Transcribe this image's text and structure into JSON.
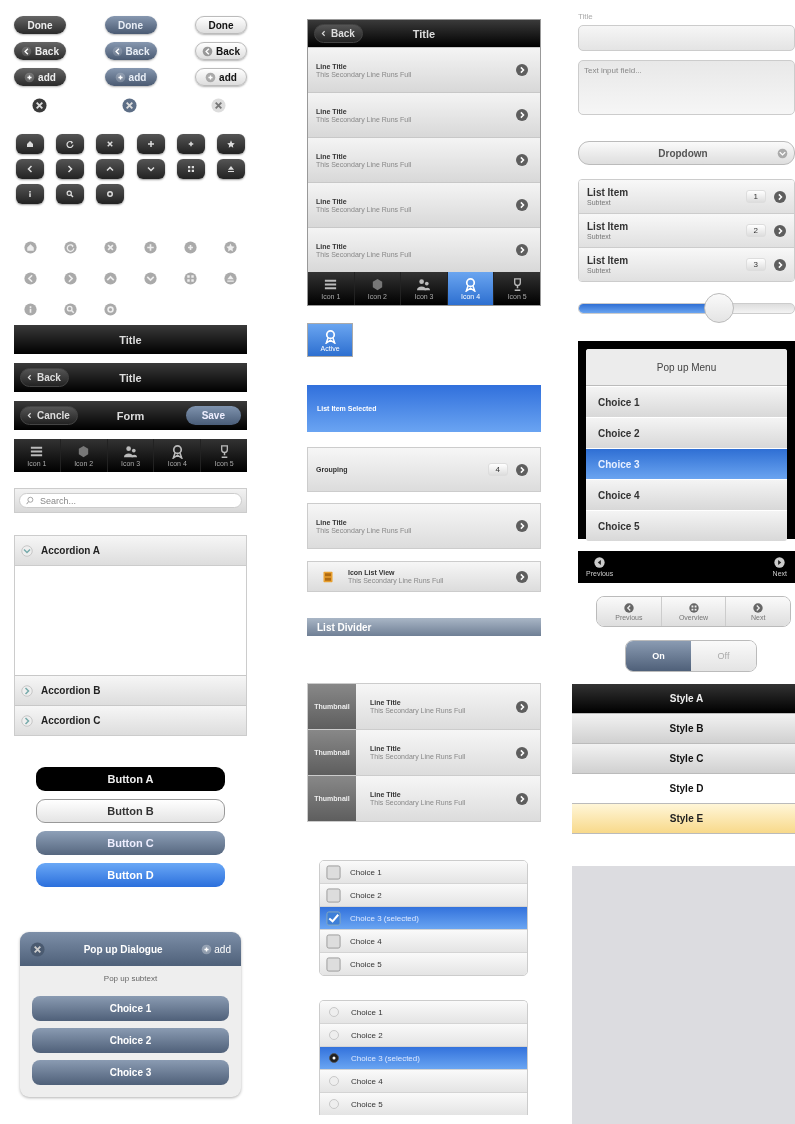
{
  "button_rows": [
    [
      {
        "kind": "text",
        "label": "Done"
      },
      {
        "kind": "text",
        "label": "Done"
      },
      {
        "kind": "text",
        "label": "Done"
      }
    ],
    [
      {
        "kind": "back",
        "label": "Back"
      },
      {
        "kind": "back",
        "label": "Back"
      },
      {
        "kind": "back",
        "label": "Back"
      }
    ],
    [
      {
        "kind": "add",
        "label": "add"
      },
      {
        "kind": "add",
        "label": "add"
      },
      {
        "kind": "add",
        "label": "add"
      }
    ],
    [
      {
        "kind": "close"
      },
      {
        "kind": "close"
      },
      {
        "kind": "close"
      }
    ]
  ],
  "title_bar": {
    "title": "Title"
  },
  "back_bar": {
    "back": "Back",
    "title": "Title"
  },
  "form_bar": {
    "cancel": "Cancle",
    "title": "Form",
    "save": "Save"
  },
  "tab_bar": [
    {
      "label": "Icon 1",
      "selected": false
    },
    {
      "label": "Icon 2",
      "selected": false
    },
    {
      "label": "Icon 3",
      "selected": false
    },
    {
      "label": "Icon 4",
      "selected": false
    },
    {
      "label": "Icon 5",
      "selected": false
    }
  ],
  "search": {
    "placeholder": "Search..."
  },
  "accordion": [
    {
      "title": "Accordion A",
      "expanded": true
    },
    {
      "title": "Accordion B",
      "expanded": false
    },
    {
      "title": "Accordion C",
      "expanded": false
    }
  ],
  "style_buttons": [
    {
      "label": "Button A"
    },
    {
      "label": "Button B"
    },
    {
      "label": "Button C"
    },
    {
      "label": "Button D"
    }
  ],
  "dialog": {
    "title": "Pop up Dialogue",
    "add": "add",
    "subtext": "Pop up subtext",
    "choices": [
      "Choice 1",
      "Choice 2",
      "Choice 3"
    ]
  },
  "phone": {
    "back": "Back",
    "title": "Title",
    "rows": [
      {
        "title": "Line Title",
        "subtitle": "This Secondary Line Runs Full"
      },
      {
        "title": "Line Title",
        "subtitle": "This Secondary Line Runs Full"
      },
      {
        "title": "Line Title",
        "subtitle": "This Secondary Line Runs Full"
      },
      {
        "title": "Line Title",
        "subtitle": "This Secondary Line Runs Full"
      },
      {
        "title": "Line Title",
        "subtitle": "This Secondary Line Runs Full"
      }
    ],
    "tabs": [
      {
        "label": "Icon 1",
        "selected": false
      },
      {
        "label": "Icon 2",
        "selected": false
      },
      {
        "label": "Icon 3",
        "selected": false
      },
      {
        "label": "Icon 4",
        "selected": true
      },
      {
        "label": "Icon 5",
        "selected": false
      }
    ]
  },
  "active_tab": {
    "label": "Active",
    "selected": true
  },
  "selected_item": {
    "label": "List Item Selected",
    "selected": true
  },
  "grouping": {
    "label": "Grouping",
    "count": "4"
  },
  "line_item": {
    "title": "Line Title",
    "subtitle": "This Secondary Line Runs Full"
  },
  "icon_item": {
    "title": "Icon List View",
    "subtitle": "This Secondary Line Runs Full"
  },
  "list_divider": "List Divider",
  "thumb_list": [
    {
      "thumbnail": "Thumbnail",
      "title": "Line Title",
      "subtitle": "This Secondary Line Runs Full"
    },
    {
      "thumbnail": "Thumbnail",
      "title": "Line Title",
      "subtitle": "This Secondary Line Runs Full"
    },
    {
      "thumbnail": "Thumbnail",
      "title": "Line Title",
      "subtitle": "This Secondary Line Runs Full"
    }
  ],
  "checkbox_list": [
    {
      "label": "Choice 1",
      "checked": false
    },
    {
      "label": "Choice 2",
      "checked": false
    },
    {
      "label": "Choice 3 (selected)",
      "checked": true
    },
    {
      "label": "Choice 4",
      "checked": false
    },
    {
      "label": "Choice 5",
      "checked": false
    }
  ],
  "radio_list": [
    {
      "label": "Choice 1",
      "selected": false
    },
    {
      "label": "Choice 2",
      "selected": false
    },
    {
      "label": "Choice 3 (selected)",
      "selected": true
    },
    {
      "label": "Choice 4",
      "selected": false
    },
    {
      "label": "Choice 5",
      "selected": false
    }
  ],
  "title_field": {
    "label": "Title"
  },
  "textarea": {
    "placeholder": "Text input field..."
  },
  "dropdown": {
    "label": "Dropdown"
  },
  "count_list": [
    {
      "title": "List Item",
      "subtitle": "Subtext",
      "count": "1"
    },
    {
      "title": "List Item",
      "subtitle": "Subtext",
      "count": "2"
    },
    {
      "title": "List Item",
      "subtitle": "Subtext",
      "count": "3"
    }
  ],
  "slider": {
    "level": 0.65
  },
  "popup_menu": {
    "title": "Pop up Menu",
    "choices": [
      {
        "label": "Choice 1",
        "selected": false
      },
      {
        "label": "Choice 2",
        "selected": false
      },
      {
        "label": "Choice 3",
        "selected": true
      },
      {
        "label": "Choice 4",
        "selected": false
      },
      {
        "label": "Choice 5",
        "selected": false
      }
    ]
  },
  "pager": {
    "previous": "Previous",
    "next": "Next"
  },
  "segmented": [
    {
      "label": "Previous"
    },
    {
      "label": "Overview"
    },
    {
      "label": "Next"
    }
  ],
  "toggle": [
    {
      "label": "On",
      "selected": true
    },
    {
      "label": "Off",
      "selected": false
    }
  ],
  "styles": [
    {
      "label": "Style A",
      "kind": "black"
    },
    {
      "label": "Style B",
      "kind": "gray"
    },
    {
      "label": "Style C",
      "kind": "gray"
    },
    {
      "label": "Style D",
      "kind": "white"
    },
    {
      "label": "Style E",
      "kind": "yellow"
    }
  ]
}
